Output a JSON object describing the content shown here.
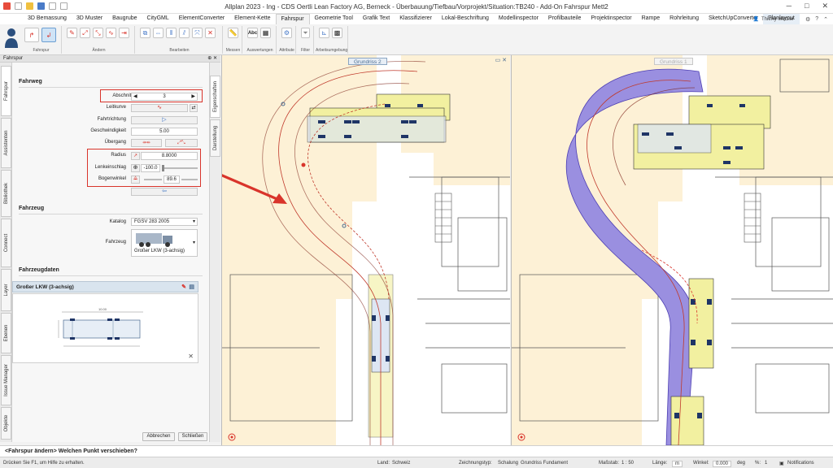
{
  "window": {
    "title": "Allplan 2023 - Ing - CDS Oertli Lean Factory AG, Berneck - Überbauung/Tiefbau/Vorprojekt/Situation:TB240 - Add-On Fahrspur Mett2",
    "minimize": "─",
    "maximize": "□",
    "close": "✕"
  },
  "ribbon_tabs": [
    "3D Bemassung",
    "3D Muster",
    "Baugrube",
    "CityGML",
    "ElementConverter",
    "Element-Kette",
    "Fahrspur",
    "Geometrie Tool",
    "Grafik Text",
    "Klassifizierer",
    "Lokal-Beschriftung",
    "Modellinspector",
    "Profilbauteile",
    "Projektinspector",
    "Rampe",
    "Rohrleitung",
    "SketchUpConverter",
    "Planlayout"
  ],
  "user": {
    "name": "Thierry Metzler"
  },
  "ribbon_groups": [
    {
      "label": "Fahrspur"
    },
    {
      "label": "Ändern"
    },
    {
      "label": "Bearbeiten"
    },
    {
      "label": "Messen"
    },
    {
      "label": "Auswertungen"
    },
    {
      "label": "Attribute"
    },
    {
      "label": "Filter"
    },
    {
      "label": "Arbeitsumgebung"
    }
  ],
  "panel": {
    "title": "Fahrspur",
    "controls": "⊕ ✕",
    "left_tabs": [
      "Fahrspur",
      "Assistenten",
      "Bibliothek",
      "Connect",
      "Layer",
      "Ebenen",
      "Issue Manager",
      "Objekte"
    ],
    "right_tabs": [
      "Eigenschaften",
      "Darstellung"
    ],
    "fahrweg": {
      "heading": "Fahrweg",
      "abschnitt_label": "Abschnitt",
      "abschnitt_value": "3",
      "leitkurve_label": "Leitkurve",
      "fahrtrichtung_label": "Fahrtrichtung",
      "geschwindigkeit_label": "Geschwindigkeit",
      "geschwindigkeit_value": "5.00",
      "uebergang_label": "Übergang",
      "radius_label": "Radius",
      "radius_value": "8.8000",
      "lenkeinschlag_label": "Lenkeinschlag",
      "lenkeinschlag_value": "-100.0",
      "bogenwinkel_label": "Bogenwinkel",
      "bogenwinkel_value": "89.6"
    },
    "fahrzeug": {
      "heading": "Fahrzeug",
      "katalog_label": "Katalog",
      "katalog_value": "FGSV 283 2005",
      "fahrzeug_label": "Fahrzeug",
      "fahrzeug_value": "Großer LKW (3-achsig)"
    },
    "fahrzeugdaten": {
      "heading": "Fahrzeugdaten",
      "vehicle_name": "Großer LKW (3-achsig)",
      "dim_total": "10.00"
    },
    "buttons": {
      "cancel": "Abbrechen",
      "close": "Schließen"
    }
  },
  "viewports": {
    "left_label": "Grundriss 2",
    "right_label": "Grundriss 1"
  },
  "command_line": "<Fahrspur ändern> Welchen Punkt verschieben?",
  "status": {
    "hint": "Drücken Sie F1, um Hilfe zu erhalten.",
    "land_label": "Land:",
    "land_value": "Schweiz",
    "zeichnungstyp_label": "Zeichnungstyp:",
    "zeichnungstyp_value": "Schalung",
    "fundament_value": "Grundriss Fundament",
    "massstab_label": "Maßstab:",
    "massstab_value": "1 : 50",
    "laenge_label": "Länge:",
    "laenge_value": "m",
    "winkel_label": "Winkel:",
    "winkel_value": "0.000",
    "winkel_unit": "deg",
    "percent_label": "%:",
    "percent_value": "1",
    "notifications": "Notifications"
  },
  "colors": {
    "accent": "#3b72c4",
    "highlight_red": "#d9342b",
    "vehicle_path": "#9a8fe0",
    "building_yellow": "#f2f0a0",
    "terrain_beige": "#fdf1d6"
  }
}
